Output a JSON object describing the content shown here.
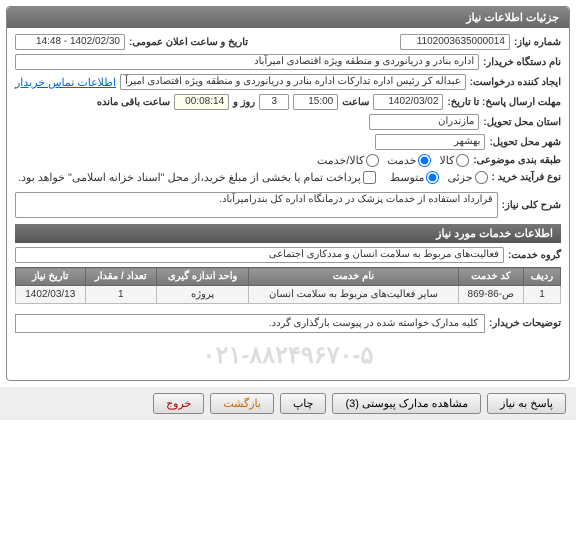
{
  "panel_title": "جزئیات اطلاعات نیاز",
  "fields": {
    "need_no_label": "شماره نیاز:",
    "need_no": "1102003635000014",
    "pub_date_label": "تاریخ و ساعت اعلان عمومی:",
    "pub_date": "1402/02/30 - 14:48",
    "buyer_org_label": "نام دستگاه خریدار:",
    "buyer_org": "اداره بنادر و دریانوردی و منطقه ویژه اقتصادی امیرآباد",
    "creator_label": "ایجاد کننده درخواست:",
    "creator": "عبداله کر رئیس اداره تدارکات اداره بنادر و دریانوردی و منطقه ویژه اقتصادی امیرآ",
    "contact_link": "اطلاعات تماس خریدار",
    "deadline_label": "مهلت ارسال پاسخ: تا تاریخ:",
    "deadline_date": "1402/03/02",
    "time_label": "ساعت",
    "deadline_time": "15:00",
    "days_label": "روز و",
    "days": "3",
    "remaining_label": "ساعت باقی مانده",
    "remaining": "00:08:14",
    "province_label": "استان محل تحویل:",
    "province": "مازندران",
    "city_label": "شهر محل تحویل:",
    "city": "بهشهر",
    "subject_class_label": "طبقه بندی موضوعی:",
    "radio_kala": "کالا",
    "radio_khedmat": "خدمت",
    "radio_kala_khedmat": "کالا/خدمت",
    "process_type_label": "نوع فرآیند خرید :",
    "radio_partial": "جزئی",
    "radio_medium": "متوسط",
    "payment_note": "پرداخت تمام یا بخشی از مبلغ خرید،از محل \"اسناد خزانه اسلامی\" خواهد بود.",
    "desc_label": "شرح کلی نیاز:",
    "desc": "قرارداد استفاده از خدمات پزشک در درمانگاه اداره کل بندرامیرآباد.",
    "services_header": "اطلاعات خدمات مورد نیاز",
    "service_group_label": "گروه خدمت:",
    "service_group": "فعالیت‌های مربوط به سلامت انسان و مددکاری اجتماعی",
    "buyer_notes_label": "توضیحات خریدار:",
    "buyer_notes": "کلیه مدارک خواسته شده در پیوست بارگذاری گردد."
  },
  "table": {
    "headers": {
      "row": "ردیف",
      "code": "کد خدمت",
      "name": "نام خدمت",
      "unit": "واحد اندازه گیری",
      "qty": "تعداد / مقدار",
      "date": "تاریخ نیاز"
    },
    "rows": [
      {
        "row": "1",
        "code": "ص-86-869",
        "name": "سایر فعالیت‌های مربوط به سلامت انسان",
        "unit": "پروژه",
        "qty": "1",
        "date": "1402/03/13"
      }
    ]
  },
  "watermark": "۰۲۱-۸۸۲۴۹۶۷۰-۵",
  "buttons": {
    "respond": "پاسخ به نیاز",
    "attachments": "مشاهده مدارک پیوستی (3)",
    "print": "چاپ",
    "back": "بازگشت",
    "exit": "خروج"
  }
}
